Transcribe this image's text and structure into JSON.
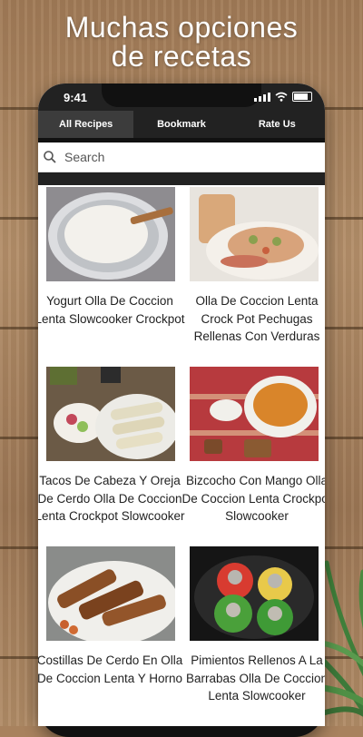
{
  "headline": {
    "line1": "Muchas opciones",
    "line2": "de recetas"
  },
  "status_bar": {
    "time": "9:41"
  },
  "tabs": [
    {
      "label": "All Recipes",
      "active": true
    },
    {
      "label": "Bookmark",
      "active": false
    },
    {
      "label": "Rate Us",
      "active": false
    }
  ],
  "search": {
    "placeholder": "Search",
    "icon": "search-icon"
  },
  "recipes": [
    {
      "title": "Yogurt Olla De Coccion Lenta Slowcooker Crockpot"
    },
    {
      "title": "Olla De Coccion Lenta Crock Pot Pechugas Rellenas Con Verduras"
    },
    {
      "title": "Tacos De Cabeza Y Oreja De Cerdo Olla De Coccion Lenta Crockpot Slowcooker"
    },
    {
      "title": "Bizcocho Con Mango Olla De Coccion Lenta Crockpot Slowcooker"
    },
    {
      "title": "Costillas De Cerdo En Olla De Coccion Lenta Y Horno"
    },
    {
      "title": "Pimientos Rellenos A La Barrabas Olla De Coccion Lenta Slowcooker"
    }
  ],
  "colors": {
    "tab_bar": "#222222",
    "active_tab": "#3c3c3c",
    "headline_text": "#ffffff"
  }
}
